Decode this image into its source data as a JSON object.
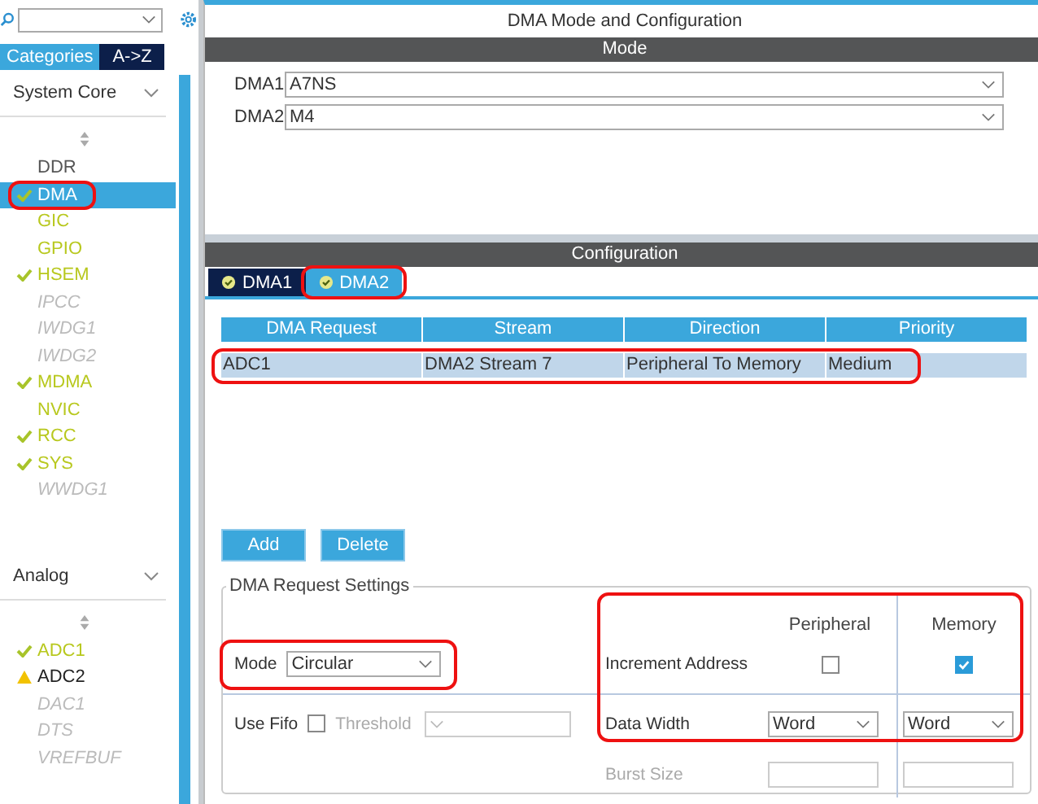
{
  "sidebar": {
    "tabs": [
      {
        "label": "Categories",
        "selected": true
      },
      {
        "label": "A->Z",
        "selected": false
      }
    ],
    "groups": [
      {
        "title": "System Core",
        "items": [
          {
            "label": "DDR",
            "kind": "plain",
            "selected": false,
            "annotated": false
          },
          {
            "label": "DMA",
            "kind": "configured",
            "selected": true,
            "annotated": true
          },
          {
            "label": "GIC",
            "kind": "available",
            "selected": false,
            "annotated": false
          },
          {
            "label": "GPIO",
            "kind": "available",
            "selected": false,
            "annotated": false
          },
          {
            "label": "HSEM",
            "kind": "configured",
            "selected": false,
            "annotated": false
          },
          {
            "label": "IPCC",
            "kind": "unavailable",
            "selected": false,
            "annotated": false
          },
          {
            "label": "IWDG1",
            "kind": "unavailable",
            "selected": false,
            "annotated": false
          },
          {
            "label": "IWDG2",
            "kind": "unavailable",
            "selected": false,
            "annotated": false
          },
          {
            "label": "MDMA",
            "kind": "configured",
            "selected": false,
            "annotated": false
          },
          {
            "label": "NVIC",
            "kind": "available",
            "selected": false,
            "annotated": false
          },
          {
            "label": "RCC",
            "kind": "configured",
            "selected": false,
            "annotated": false
          },
          {
            "label": "SYS",
            "kind": "configured",
            "selected": false,
            "annotated": false
          },
          {
            "label": "WWDG1",
            "kind": "unavailable",
            "selected": false,
            "annotated": false
          }
        ]
      },
      {
        "title": "Analog",
        "items": [
          {
            "label": "ADC1",
            "kind": "configured",
            "selected": false,
            "annotated": false
          },
          {
            "label": "ADC2",
            "kind": "warning",
            "selected": false,
            "annotated": false
          },
          {
            "label": "DAC1",
            "kind": "unavailable",
            "selected": false,
            "annotated": false
          },
          {
            "label": "DTS",
            "kind": "unavailable",
            "selected": false,
            "annotated": false
          },
          {
            "label": "VREFBUF",
            "kind": "unavailable",
            "selected": false,
            "annotated": false
          }
        ]
      }
    ]
  },
  "main": {
    "title": "DMA Mode and Configuration",
    "mode": {
      "title": "Mode",
      "fields": [
        {
          "label": "DMA1",
          "value": "A7NS"
        },
        {
          "label": "DMA2",
          "value": "M4"
        }
      ]
    },
    "configuration": {
      "title": "Configuration",
      "tabs": [
        {
          "label": "DMA1",
          "selected": false,
          "annotated": false
        },
        {
          "label": "DMA2",
          "selected": true,
          "annotated": true
        }
      ],
      "table": {
        "columns": [
          "DMA Request",
          "Stream",
          "Direction",
          "Priority"
        ],
        "rows": [
          {
            "cells": [
              "ADC1",
              "DMA2 Stream 7",
              "Peripheral To Memory",
              "Medium"
            ],
            "selected": true,
            "annotated": true
          }
        ]
      },
      "buttons": [
        "Add",
        "Delete"
      ],
      "settings": {
        "title": "DMA Request Settings",
        "mode": {
          "label": "Mode",
          "value": "Circular",
          "annotated": true
        },
        "fifo": {
          "label": "Use Fifo",
          "checked": false
        },
        "threshold": {
          "label": "Threshold",
          "disabled": true
        },
        "columns": [
          "Peripheral",
          "Memory"
        ],
        "increment": {
          "label": "Increment Address",
          "peripheral": false,
          "memory": true
        },
        "data_width": {
          "label": "Data Width",
          "peripheral": "Word",
          "memory": "Word"
        },
        "burst_size": {
          "label": "Burst Size",
          "disabled": true
        },
        "right_annotated": true
      }
    }
  }
}
